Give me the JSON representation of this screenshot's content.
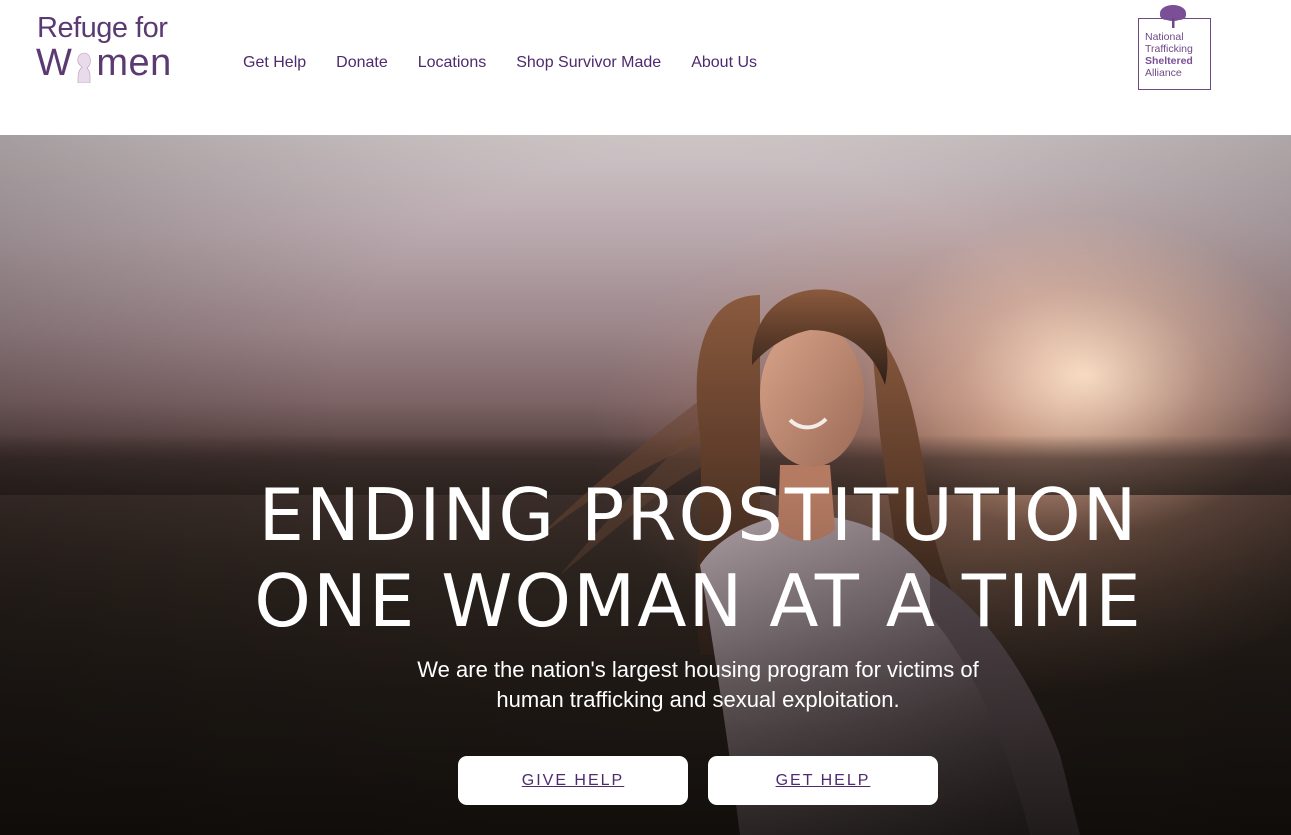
{
  "header": {
    "logo": {
      "line1": "Refuge for",
      "line2_pre": "W",
      "line2_post": "men"
    },
    "nav": [
      {
        "label": "Get Help"
      },
      {
        "label": "Donate"
      },
      {
        "label": "Locations"
      },
      {
        "label": "Shop Survivor Made"
      },
      {
        "label": "About Us"
      }
    ],
    "badge": {
      "line1": "National",
      "line2": "Trafficking",
      "line3": "Sheltered",
      "line4": "Alliance",
      "icon": "tree-icon"
    }
  },
  "hero": {
    "headline_line1": "ENDING PROSTITUTION",
    "headline_line2": "ONE WOMAN AT A TIME",
    "subtext_line1": "We are the nation's largest housing program for victims of",
    "subtext_line2": "human trafficking and sexual exploitation.",
    "buttons": {
      "give_help": "GIVE HELP",
      "get_help": "GET HELP"
    }
  },
  "colors": {
    "brand_purple": "#4e2a6e",
    "logo_purple": "#5b3a72",
    "white": "#ffffff"
  }
}
